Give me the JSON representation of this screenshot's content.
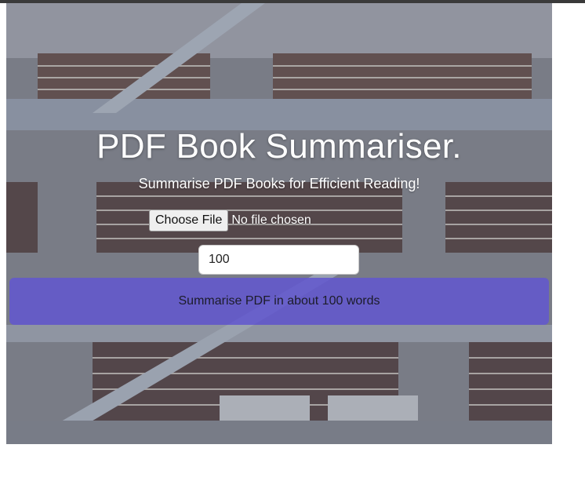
{
  "header": {
    "title": "PDF Book Summariser.",
    "subtitle": "Summarise PDF Books for Efficient Reading!"
  },
  "upload": {
    "button_label": "Choose File",
    "status": "No file chosen"
  },
  "word_count": {
    "value": "100"
  },
  "submit": {
    "label": "Summarise PDF in about 100 words"
  },
  "theme": {
    "accent": "#6258ce",
    "text_on_dark": "#ffffff"
  }
}
